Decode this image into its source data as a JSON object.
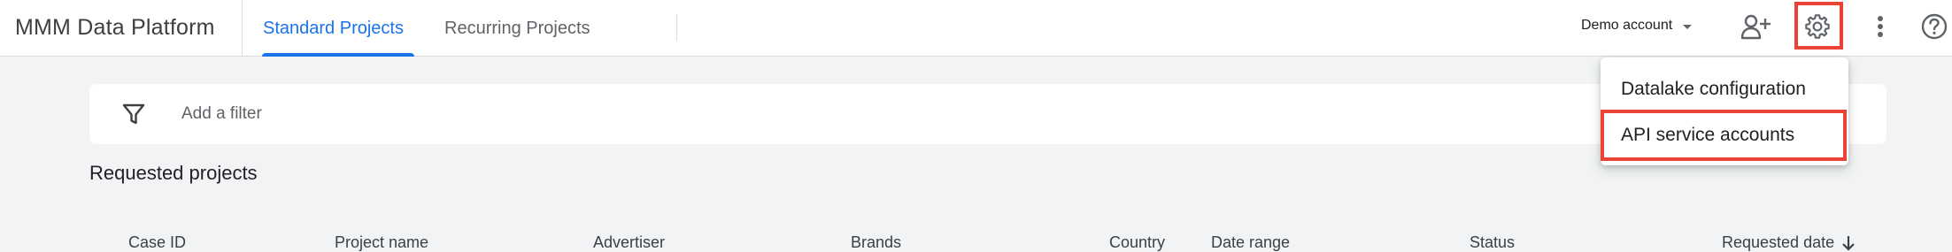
{
  "app": {
    "title": "MMM Data Platform"
  },
  "tabs": [
    {
      "label": "Standard Projects",
      "active": true
    },
    {
      "label": "Recurring Projects",
      "active": false
    }
  ],
  "header": {
    "account_label": "Demo account",
    "icons": [
      "add-user-icon",
      "gear-icon",
      "more-vert-icon",
      "help-icon"
    ]
  },
  "filter": {
    "placeholder": "Add a filter"
  },
  "section": {
    "title": "Requested projects"
  },
  "table": {
    "columns": [
      "Case ID",
      "Project name",
      "Advertiser",
      "Brands",
      "Country",
      "Date range",
      "Status",
      "Requested date"
    ],
    "sort_column": "Requested date",
    "sort_direction": "descending"
  },
  "settings_menu": {
    "items": [
      "Datalake configuration",
      "API service accounts"
    ],
    "highlighted_item": "API service accounts"
  },
  "colors": {
    "accent": "#1a73e8",
    "highlight": "#ea4335",
    "background": "#f1f3f4"
  }
}
